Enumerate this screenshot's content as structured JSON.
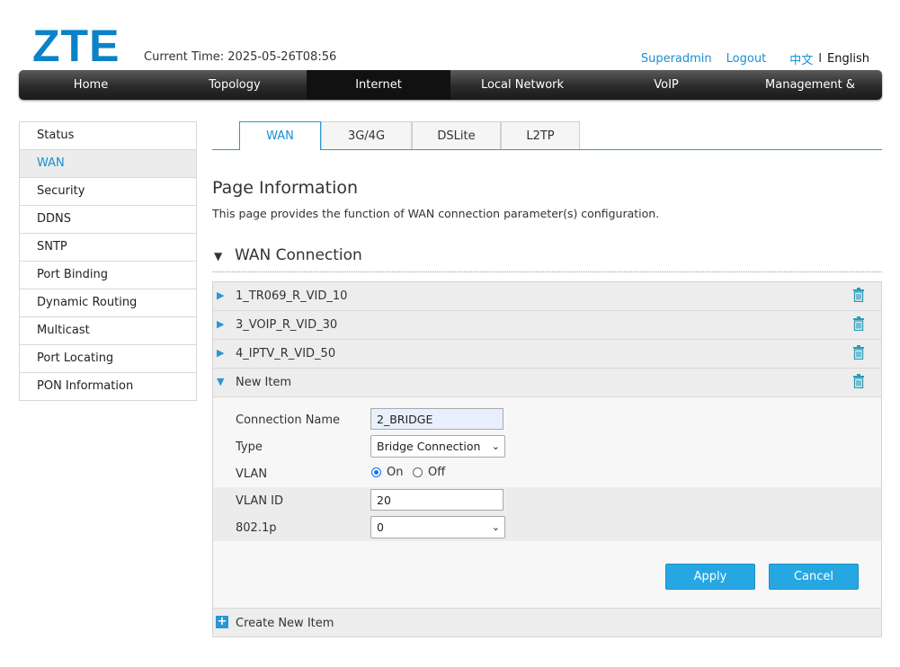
{
  "header": {
    "logo": "ZTE",
    "current_time": "Current Time: 2025-05-26T08:56",
    "links": {
      "superadmin": "Superadmin",
      "logout": "Logout",
      "chinese": "中文",
      "separator": "I",
      "english": "English"
    }
  },
  "nav": {
    "items": [
      {
        "label": "Home"
      },
      {
        "label": "Topology"
      },
      {
        "label": "Internet"
      },
      {
        "label": "Local Network"
      },
      {
        "label": "VoIP"
      },
      {
        "label": "Management & Diagnosis"
      }
    ],
    "active": "Internet"
  },
  "sidebar": {
    "items": [
      {
        "label": "Status"
      },
      {
        "label": "WAN"
      },
      {
        "label": "Security"
      },
      {
        "label": "DDNS"
      },
      {
        "label": "SNTP"
      },
      {
        "label": "Port Binding"
      },
      {
        "label": "Dynamic Routing"
      },
      {
        "label": "Multicast"
      },
      {
        "label": "Port Locating"
      },
      {
        "label": "PON Information"
      }
    ],
    "active": "WAN"
  },
  "tabs": [
    {
      "label": "WAN"
    },
    {
      "label": "3G/4G"
    },
    {
      "label": "DSLite"
    },
    {
      "label": "L2TP"
    }
  ],
  "page": {
    "title": "Page Information",
    "description": "This page provides the function of WAN connection parameter(s) configuration.",
    "section_title": "WAN Connection"
  },
  "connections": [
    {
      "name": "1_TR069_R_VID_10"
    },
    {
      "name": "3_VOIP_R_VID_30"
    },
    {
      "name": "4_IPTV_R_VID_50"
    },
    {
      "name": "New Item"
    }
  ],
  "form": {
    "connection_name_label": "Connection Name",
    "connection_name_value": "2_BRIDGE",
    "type_label": "Type",
    "type_value": "Bridge Connection",
    "vlan_label": "VLAN",
    "vlan_on": "On",
    "vlan_off": "Off",
    "vlan_selected": "On",
    "vlan_id_label": "VLAN ID",
    "vlan_id_value": "20",
    "p8021_label": "802.1p",
    "p8021_value": "0",
    "apply": "Apply",
    "cancel": "Cancel"
  },
  "create_new_item": "Create New Item",
  "colors": {
    "accent": "#1a8fd1",
    "button": "#26a7e2",
    "logo": "#0a82c8"
  }
}
